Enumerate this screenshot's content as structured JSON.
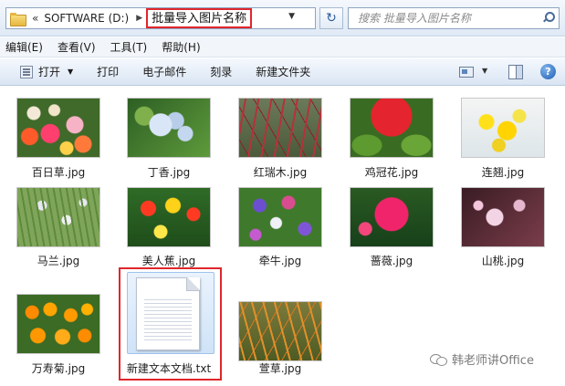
{
  "address": {
    "back_chevron": "«",
    "drive": "SOFTWARE (D:)",
    "separator": "▶",
    "current_folder": "批量导入图片名称",
    "dropdown_arrow": "▼",
    "refresh_glyph": "↻"
  },
  "search": {
    "placeholder": "搜索 批量导入图片名称"
  },
  "menu": [
    "编辑(E)",
    "查看(V)",
    "工具(T)",
    "帮助(H)"
  ],
  "toolbar": {
    "open_label": "打开",
    "open_caret": "▼",
    "print_label": "打印",
    "email_label": "电子邮件",
    "burn_label": "刻录",
    "newfolder_label": "新建文件夹",
    "view_caret": "▼",
    "help_label": "?"
  },
  "files": [
    {
      "name": "百日草.jpg",
      "thumb": "zinnia"
    },
    {
      "name": "丁香.jpg",
      "thumb": "clove"
    },
    {
      "name": "红瑞木.jpg",
      "thumb": "dogwood"
    },
    {
      "name": "鸡冠花.jpg",
      "thumb": "cockscomb"
    },
    {
      "name": "连翘.jpg",
      "thumb": "forsythia"
    },
    {
      "name": "马兰.jpg",
      "thumb": "iris"
    },
    {
      "name": "美人蕉.jpg",
      "thumb": "canna"
    },
    {
      "name": "牵牛.jpg",
      "thumb": "morning-glory"
    },
    {
      "name": "蔷薇.jpg",
      "thumb": "rose"
    },
    {
      "name": "山桃.jpg",
      "thumb": "peach"
    },
    {
      "name": "万寿菊.jpg",
      "thumb": "marigold"
    },
    {
      "name": "新建文本文档.txt",
      "thumb": "text-document"
    },
    {
      "name": "萱草.jpg",
      "thumb": "daylily"
    }
  ],
  "highlight_color": "#e0262b",
  "watermark": {
    "text": "韩老师讲Office"
  }
}
